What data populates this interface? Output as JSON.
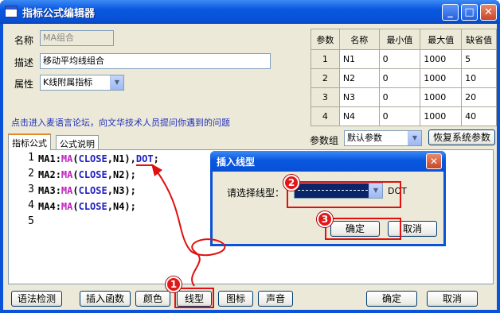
{
  "window": {
    "title": "指标公式编辑器",
    "minimize": "_",
    "maximize": "□",
    "close": "✕"
  },
  "form": {
    "name_label": "名称",
    "name_value": "MA组合",
    "desc_label": "描述",
    "desc_value": "移动平均线组合",
    "attr_label": "属性",
    "attr_value": "K线附属指标"
  },
  "link_text": "点击进入麦语言论坛，向文华技术人员提问你遇到的问题",
  "params": {
    "headers": [
      "参数",
      "名称",
      "最小值",
      "最大值",
      "缺省值"
    ],
    "rows": [
      [
        "1",
        "N1",
        "0",
        "1000",
        "5"
      ],
      [
        "2",
        "N2",
        "0",
        "1000",
        "10"
      ],
      [
        "3",
        "N3",
        "0",
        "1000",
        "20"
      ],
      [
        "4",
        "N4",
        "0",
        "1000",
        "40"
      ]
    ]
  },
  "param_group": {
    "label": "参数组",
    "value": "默认参数",
    "restore_button": "恢复系统参数"
  },
  "tabs": [
    "指标公式",
    "公式说明"
  ],
  "code_lines": [
    {
      "num": "1",
      "var": "MA1",
      "fn": "MA",
      "arg": "CLOSE",
      "n": "N1",
      "extra": "DOT"
    },
    {
      "num": "2",
      "var": "MA2",
      "fn": "MA",
      "arg": "CLOSE",
      "n": "N2"
    },
    {
      "num": "3",
      "var": "MA3",
      "fn": "MA",
      "arg": "CLOSE",
      "n": "N3"
    },
    {
      "num": "4",
      "var": "MA4",
      "fn": "MA",
      "arg": "CLOSE",
      "n": "N4"
    },
    {
      "num": "5"
    }
  ],
  "bottom_buttons": {
    "syntax_check": "语法检测",
    "insert_function": "插入函数",
    "color": "颜色",
    "line_type": "线型",
    "icon": "图标",
    "sound": "声音",
    "ok": "确定",
    "cancel": "取消"
  },
  "dialog": {
    "title": "插入线型",
    "close": "✕",
    "select_label": "请选择线型：",
    "line_name": "DOT",
    "ok": "确定",
    "cancel": "取消"
  },
  "badges": [
    "1",
    "2",
    "3"
  ],
  "colors": {
    "highlight": "#e01010",
    "titlebar": "#0a58e0"
  }
}
